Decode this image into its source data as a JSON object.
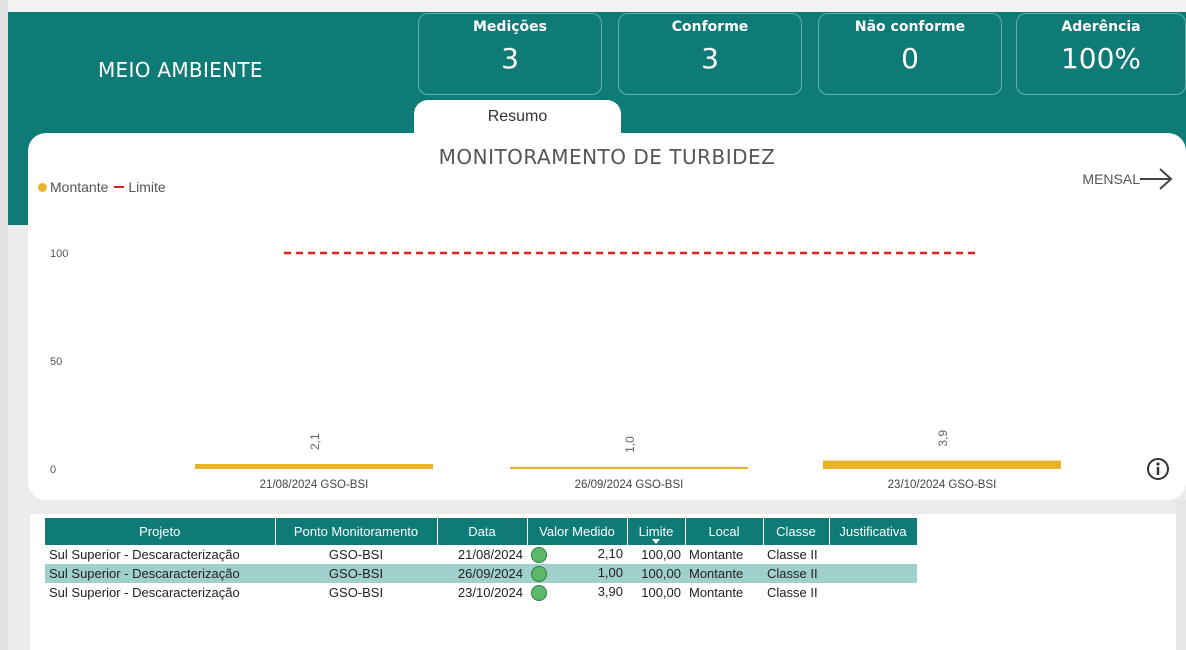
{
  "header": {
    "section_title": "MEIO AMBIENTE",
    "kpis": [
      {
        "label": "Medições",
        "value": "3"
      },
      {
        "label": "Conforme",
        "value": "3"
      },
      {
        "label": "Não conforme",
        "value": "0"
      },
      {
        "label": "Aderência",
        "value": "100%"
      }
    ],
    "tab_label": "Resumo"
  },
  "chart_controls": {
    "period_label": "MENSAL",
    "arrow_icon": "arrow-right-icon",
    "info_icon": "info-icon"
  },
  "chart_data": {
    "type": "bar",
    "title": "MONITORAMENTO DE TURBIDEZ",
    "categories": [
      "21/08/2024 GSO-BSI",
      "26/09/2024 GSO-BSI",
      "23/10/2024 GSO-BSI"
    ],
    "series": [
      {
        "name": "Montante",
        "values": [
          2.1,
          1.0,
          3.9
        ],
        "color": "#e8b22a"
      },
      {
        "name": "Limite",
        "values": [
          100,
          100,
          100
        ],
        "color": "#e02020",
        "style": "dashed-line"
      }
    ],
    "data_labels": [
      "2,1",
      "1,0",
      "3,9"
    ],
    "y_ticks": [
      "0",
      "50",
      "100"
    ],
    "ylim": [
      0,
      100
    ],
    "legend_position": "top-left"
  },
  "table": {
    "columns": [
      "Projeto",
      "Ponto Monitoramento",
      "Data",
      "Valor Medido",
      "Limite",
      "Local",
      "Classe",
      "Justificativa"
    ],
    "rows": [
      {
        "projeto": "Sul Superior - Descaracterização",
        "ponto": "GSO-BSI",
        "data": "21/08/2024",
        "valor": "2,10",
        "limite": "100,00",
        "local": "Montante",
        "classe": "Classe II",
        "justificativa": ""
      },
      {
        "projeto": "Sul Superior - Descaracterização",
        "ponto": "GSO-BSI",
        "data": "26/09/2024",
        "valor": "1,00",
        "limite": "100,00",
        "local": "Montante",
        "classe": "Classe II",
        "justificativa": ""
      },
      {
        "projeto": "Sul Superior - Descaracterização",
        "ponto": "GSO-BSI",
        "data": "23/10/2024",
        "valor": "3,90",
        "limite": "100,00",
        "local": "Montante",
        "classe": "Classe II",
        "justificativa": ""
      }
    ],
    "status_color": "#5cb86a"
  },
  "colors": {
    "brand": "#0f7b76",
    "highlight_row": "#9fd0cc"
  }
}
